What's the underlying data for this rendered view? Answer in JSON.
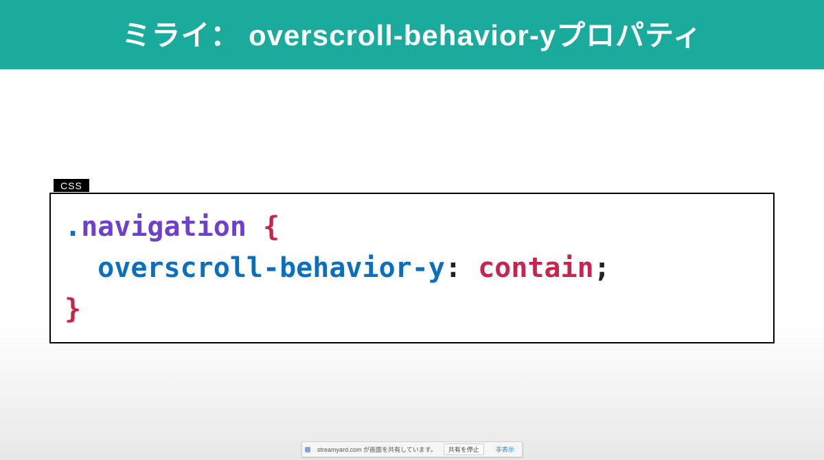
{
  "title": "ミライ： overscroll-behavior-yプロパティ",
  "code": {
    "label": "CSS",
    "tokens": {
      "dot": ".",
      "selector": "navigation",
      "brace_open": "{",
      "indent": "  ",
      "property": "overscroll-behavior-y",
      "colon": ":",
      "space": " ",
      "value": "contain",
      "semicolon": ";",
      "brace_close": "}"
    }
  },
  "share_bar": {
    "message": "streamyard.com が画面を共有しています。",
    "stop": "共有を停止",
    "hide": "非表示"
  }
}
